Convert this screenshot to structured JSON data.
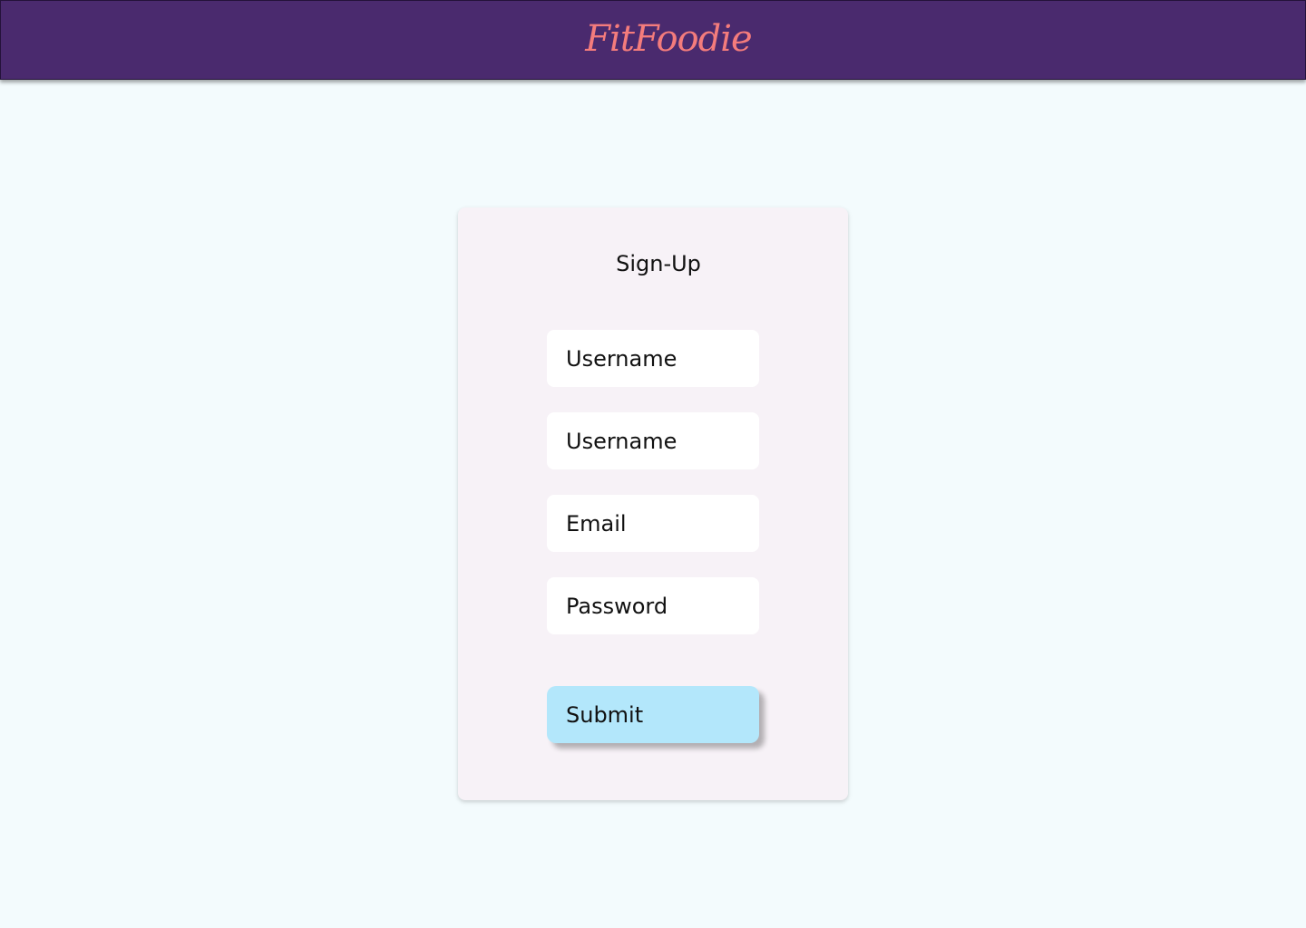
{
  "header": {
    "logo_text": "FitFoodie",
    "background_color": "#4a2a6e",
    "logo_color": "#f47c7c"
  },
  "signup_form": {
    "title": "Sign-Up",
    "fields": [
      {
        "placeholder": "Username",
        "value": ""
      },
      {
        "placeholder": "Username",
        "value": ""
      },
      {
        "placeholder": "Email",
        "value": ""
      },
      {
        "placeholder": "Password",
        "value": ""
      }
    ],
    "submit_label": "Submit",
    "submit_color": "#b3e7fb"
  }
}
